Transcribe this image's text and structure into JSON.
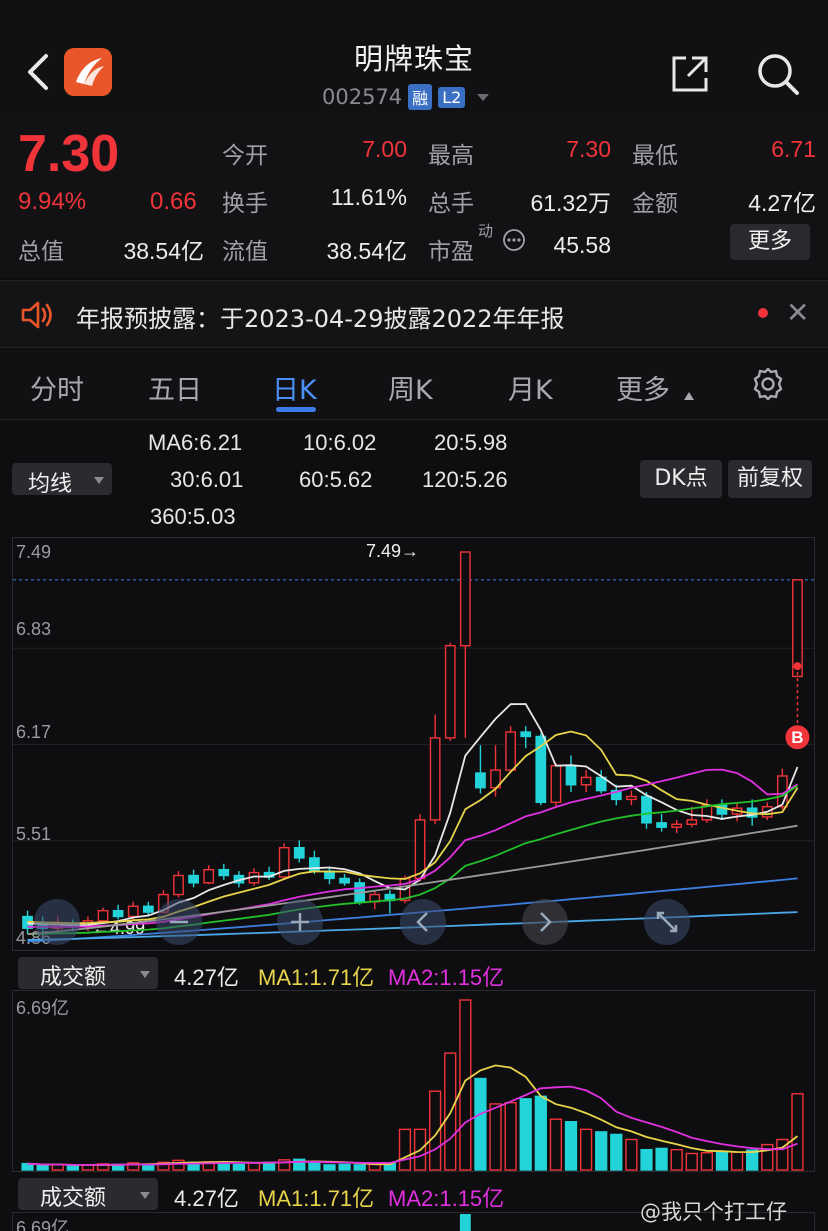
{
  "header": {
    "title": "明牌珠宝",
    "code": "002574",
    "tag_margin": "融",
    "tag_level": "L2"
  },
  "quote": {
    "price": "7.30",
    "change_pct": "9.94%",
    "change": "0.66",
    "fields": [
      {
        "label": "今开",
        "value": "7.00"
      },
      {
        "label": "最高",
        "value": "7.30"
      },
      {
        "label": "最低",
        "value": "6.71"
      },
      {
        "label": "换手",
        "value": "11.61%"
      },
      {
        "label": "总手",
        "value": "61.32万"
      },
      {
        "label": "金额",
        "value": "4.27亿"
      },
      {
        "label": "总值",
        "value": "38.54亿"
      },
      {
        "label": "流值",
        "value": "38.54亿"
      },
      {
        "label": "市盈",
        "value": "45.58"
      }
    ],
    "pe_sup": "动",
    "more_label": "更多"
  },
  "notice": {
    "text": "年报预披露：于2023-04-29披露2022年年报"
  },
  "tabs": [
    "分时",
    "五日",
    "日K",
    "周K",
    "月K",
    "更多"
  ],
  "active_tab": "日K",
  "ma_legend": {
    "ma_selector": "均线",
    "items": [
      {
        "label": "MA6:6.21",
        "color": "#e8e8e8"
      },
      {
        "label": "10:6.02",
        "color": "#e8d44a"
      },
      {
        "label": "20:5.98",
        "color": "#e030e0"
      },
      {
        "label": "30:6.01",
        "color": "#22c02a"
      },
      {
        "label": "60:5.62",
        "color": "#9a9a9a"
      },
      {
        "label": "120:5.26",
        "color": "#3d7fe0"
      },
      {
        "label": "360:5.03",
        "color": "#4aa8e8"
      }
    ],
    "dk_label": "DK点",
    "adjust_label": "前复权"
  },
  "kline": {
    "y_ticks": [
      "7.49",
      "6.83",
      "6.17",
      "5.51",
      "4.86"
    ],
    "high_marker": "7.49→",
    "low_marker": "←4.99",
    "signal": "B"
  },
  "volume": {
    "selector": "成交额",
    "value": "4.27亿",
    "ma1": "MA1:1.71亿",
    "ma2": "MA2:1.15亿",
    "y_top": "6.69亿"
  },
  "volume2": {
    "selector": "成交额",
    "value": "4.27亿",
    "ma1": "MA1:1.71亿",
    "ma2": "MA2:1.15亿",
    "y_top": "6.69亿"
  },
  "watermark": "@我只个打工仔",
  "colors": {
    "up": "#f0343a",
    "down": "#22d3d8",
    "accent": "#3b7ce8"
  },
  "chart_data": {
    "type": "candlestick",
    "title": "",
    "ylim": [
      4.86,
      7.49
    ],
    "candles": [
      [
        5.0,
        4.92,
        5.04,
        4.88
      ],
      [
        4.95,
        4.92,
        5.0,
        4.88
      ],
      [
        4.92,
        4.95,
        5.0,
        4.9
      ],
      [
        4.95,
        4.93,
        4.98,
        4.9
      ],
      [
        4.93,
        4.97,
        5.0,
        4.9
      ],
      [
        4.97,
        5.04,
        5.06,
        4.95
      ],
      [
        5.04,
        5.0,
        5.08,
        4.98
      ],
      [
        5.0,
        5.07,
        5.1,
        4.98
      ],
      [
        5.07,
        5.03,
        5.1,
        5.0
      ],
      [
        5.03,
        5.15,
        5.18,
        5.02
      ],
      [
        5.15,
        5.28,
        5.31,
        5.13
      ],
      [
        5.28,
        5.23,
        5.32,
        5.2
      ],
      [
        5.23,
        5.32,
        5.35,
        5.22
      ],
      [
        5.32,
        5.28,
        5.36,
        5.25
      ],
      [
        5.28,
        5.23,
        5.31,
        5.2
      ],
      [
        5.23,
        5.3,
        5.33,
        5.21
      ],
      [
        5.3,
        5.27,
        5.34,
        5.25
      ],
      [
        5.27,
        5.47,
        5.5,
        5.25
      ],
      [
        5.47,
        5.4,
        5.52,
        5.37
      ],
      [
        5.4,
        5.31,
        5.45,
        5.29
      ],
      [
        5.31,
        5.26,
        5.34,
        5.22
      ],
      [
        5.26,
        5.23,
        5.29,
        5.21
      ],
      [
        5.23,
        5.1,
        5.26,
        5.08
      ],
      [
        5.1,
        5.15,
        5.17,
        5.05
      ],
      [
        5.15,
        5.11,
        5.18,
        5.02
      ],
      [
        5.11,
        5.26,
        5.28,
        5.09
      ],
      [
        5.26,
        5.66,
        5.7,
        5.24
      ],
      [
        5.66,
        6.22,
        6.38,
        5.63
      ],
      [
        6.22,
        6.85,
        6.87,
        6.2
      ],
      [
        6.85,
        7.49,
        7.49,
        6.22
      ],
      [
        5.98,
        5.88,
        6.17,
        5.84
      ],
      [
        5.88,
        6.0,
        6.17,
        5.82
      ],
      [
        6.0,
        6.26,
        6.3,
        5.98
      ],
      [
        6.26,
        6.23,
        6.3,
        6.15
      ],
      [
        6.23,
        5.78,
        6.25,
        5.76
      ],
      [
        5.78,
        6.03,
        6.05,
        5.74
      ],
      [
        6.03,
        5.9,
        6.1,
        5.85
      ],
      [
        5.9,
        5.95,
        6.0,
        5.85
      ],
      [
        5.95,
        5.86,
        6.0,
        5.84
      ],
      [
        5.86,
        5.8,
        5.9,
        5.76
      ],
      [
        5.8,
        5.82,
        5.86,
        5.76
      ],
      [
        5.82,
        5.64,
        5.85,
        5.6
      ],
      [
        5.64,
        5.61,
        5.7,
        5.58
      ],
      [
        5.61,
        5.63,
        5.66,
        5.57
      ],
      [
        5.63,
        5.66,
        5.75,
        5.61
      ],
      [
        5.66,
        5.76,
        5.8,
        5.64
      ],
      [
        5.76,
        5.7,
        5.8,
        5.66
      ],
      [
        5.7,
        5.74,
        5.78,
        5.65
      ],
      [
        5.74,
        5.68,
        5.8,
        5.62
      ],
      [
        5.68,
        5.75,
        5.78,
        5.66
      ],
      [
        5.75,
        5.96,
        6.01,
        5.73
      ],
      [
        6.64,
        7.3,
        7.3,
        6.71
      ]
    ],
    "series": [
      {
        "name": "MA6",
        "color": "#e8e8e8"
      },
      {
        "name": "10",
        "color": "#e8d44a"
      },
      {
        "name": "20",
        "color": "#e030e0"
      },
      {
        "name": "30",
        "color": "#22c02a"
      },
      {
        "name": "60",
        "color": "#9a9a9a"
      },
      {
        "name": "120",
        "color": "#3d7fe0"
      },
      {
        "name": "360",
        "color": "#4aa8e8"
      }
    ],
    "volume_ylim": [
      0,
      6.69
    ],
    "volume": [
      0.25,
      0.18,
      0.22,
      0.15,
      0.2,
      0.24,
      0.22,
      0.28,
      0.22,
      0.3,
      0.38,
      0.3,
      0.32,
      0.3,
      0.22,
      0.28,
      0.3,
      0.4,
      0.42,
      0.3,
      0.2,
      0.22,
      0.2,
      0.22,
      0.26,
      1.6,
      1.6,
      3.1,
      4.6,
      6.69,
      3.6,
      2.6,
      2.65,
      2.8,
      2.9,
      2.0,
      1.9,
      1.6,
      1.5,
      1.4,
      1.2,
      0.8,
      0.85,
      0.8,
      0.65,
      0.68,
      0.72,
      0.7,
      0.78,
      1.0,
      1.2,
      3.0
    ]
  }
}
